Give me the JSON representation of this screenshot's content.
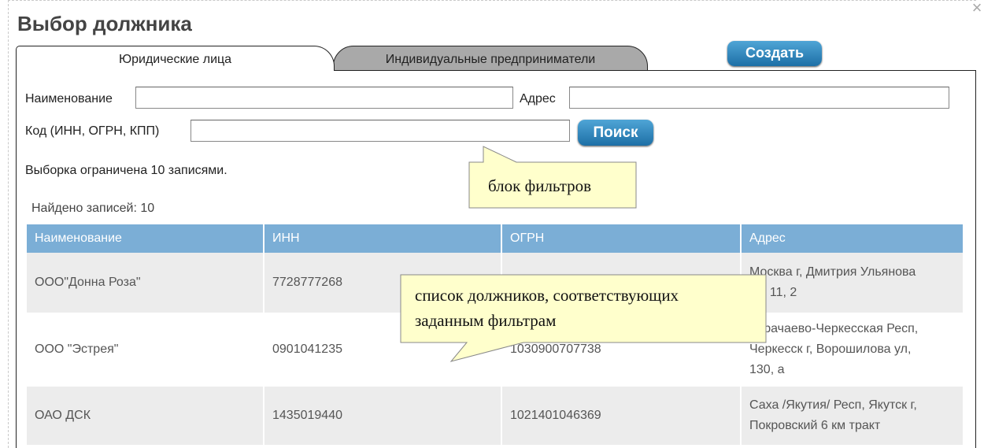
{
  "dialog": {
    "title": "Выбор должника",
    "close_glyph": "×"
  },
  "tabs": [
    {
      "label": "Юридические лица",
      "active": true
    },
    {
      "label": "Индивидуальные предприниматели",
      "active": false
    }
  ],
  "create_button": "Создать",
  "filters": {
    "name_label": "Наименование",
    "name_value": "",
    "address_label": "Адрес",
    "address_value": "",
    "code_label": "Код (ИНН, ОГРН, КПП)",
    "code_value": "",
    "search_button": "Поиск"
  },
  "limit_note": "Выборка ограничена 10 записями.",
  "found_text": "Найдено записей: 10",
  "table": {
    "columns": [
      "Наименование",
      "ИНН",
      "ОГРН",
      "Адрес"
    ],
    "rows": [
      {
        "name": "ООО\"Донна Роза\"",
        "inn": "7728777268",
        "ogrn": "",
        "address_line1": "Москва г, Дмитрия Ульянова",
        "address_line2": "ул, 11, 2",
        "address_line3": ""
      },
      {
        "name": "ООО \"Эстрея\"",
        "inn": "0901041235",
        "ogrn": "1030900707738",
        "address_line1": "Карачаево-Черкесская Респ,",
        "address_line2": "Черкесск г, Ворошилова ул,",
        "address_line3": "130, а"
      },
      {
        "name": "ОАО ДСК",
        "inn": "1435019440",
        "ogrn": "1021401046369",
        "address_line1": "Саха /Якутия/ Респ, Якутск г,",
        "address_line2": "Покровский 6 км тракт",
        "address_line3": ""
      }
    ]
  },
  "callouts": {
    "filters_block": "блок фильтров",
    "list_line1": "список должников, соответствующих",
    "list_line2": "заданным фильтрам"
  },
  "colors": {
    "header_bg": "#7baed6",
    "button_blue": "#1d6fa6",
    "callout_bg": "#ffffcc",
    "inactive_tab": "#a9a9a9"
  }
}
